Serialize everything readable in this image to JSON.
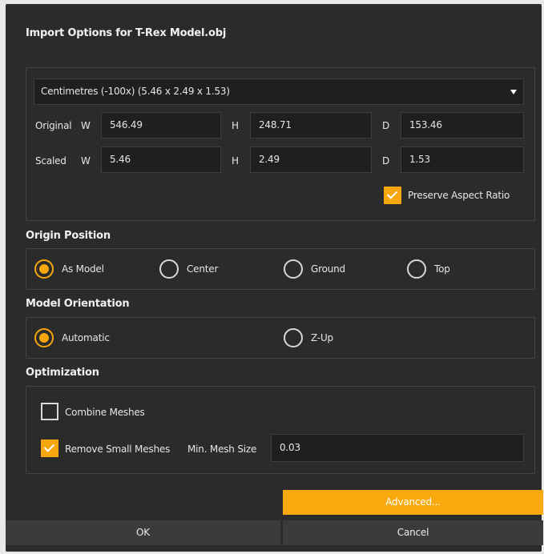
{
  "dialog": {
    "title": "Import Options for T-Rex Model.obj"
  },
  "scale": {
    "unit_selected": "Centimetres (-100x) (5.46 x 2.49 x 1.53)",
    "original_label": "Original",
    "scaled_label": "Scaled",
    "w_label": "W",
    "h_label": "H",
    "d_label": "D",
    "original": {
      "w": "546.49",
      "h": "248.71",
      "d": "153.46"
    },
    "scaled": {
      "w": "5.46",
      "h": "2.49",
      "d": "1.53"
    },
    "preserve_aspect_label": "Preserve Aspect Ratio",
    "preserve_aspect_checked": true
  },
  "origin": {
    "title": "Origin Position",
    "options": [
      "As Model",
      "Center",
      "Ground",
      "Top"
    ],
    "selected": "As Model"
  },
  "orientation": {
    "title": "Model Orientation",
    "options": [
      "Automatic",
      "Z-Up"
    ],
    "selected": "Automatic"
  },
  "optimization": {
    "title": "Optimization",
    "combine_label": "Combine Meshes",
    "combine_checked": false,
    "remove_small_label": "Remove Small Meshes",
    "remove_small_checked": true,
    "min_size_label": "Min. Mesh Size",
    "min_size_value": "0.03"
  },
  "buttons": {
    "advanced": "Advanced...",
    "ok": "OK",
    "cancel": "Cancel"
  },
  "colors": {
    "accent": "#f5a70d",
    "panel_bg": "#2b2b2b",
    "field_bg": "#1f1f1f"
  }
}
